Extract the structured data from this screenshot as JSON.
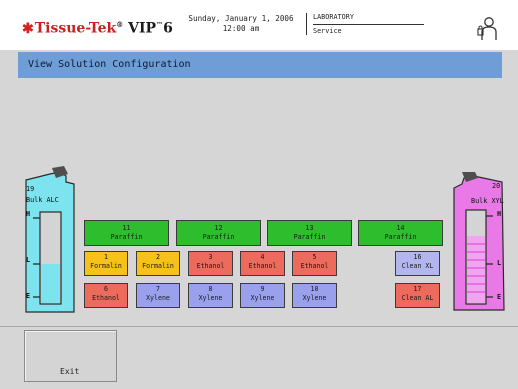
{
  "header": {
    "logo_brand": "Tissue-Tek",
    "logo_reg": "®",
    "logo_model": "VIP",
    "logo_tm": "™",
    "logo_number": "6",
    "date": "Sunday, January 1, 2006",
    "time": "12:00 am",
    "location": "LABORATORY",
    "user_level": "Service",
    "user_icon": "operator-icon"
  },
  "titlebar": {
    "title": "View Solution Configuration"
  },
  "bulk_left": {
    "number": "19",
    "label": "Bulk ALC",
    "level_high": "H",
    "level_low": "L",
    "level_empty": "E",
    "color": "#7de3ef"
  },
  "bulk_right": {
    "number": "20",
    "label": "Bulk XYL",
    "level_high": "H",
    "level_low": "L",
    "level_empty": "E",
    "color": "#e879e6"
  },
  "stations": {
    "s11": {
      "number": "11",
      "name": "Paraffin"
    },
    "s12": {
      "number": "12",
      "name": "Paraffin"
    },
    "s13": {
      "number": "13",
      "name": "Paraffin"
    },
    "s14": {
      "number": "14",
      "name": "Paraffin"
    },
    "s1": {
      "number": "1",
      "name": "Formalin"
    },
    "s2": {
      "number": "2",
      "name": "Formalin"
    },
    "s3": {
      "number": "3",
      "name": "Ethanol"
    },
    "s4": {
      "number": "4",
      "name": "Ethanol"
    },
    "s5": {
      "number": "5",
      "name": "Ethanol"
    },
    "s16": {
      "number": "16",
      "name": "Clean XL"
    },
    "s6": {
      "number": "6",
      "name": "Ethanol"
    },
    "s7": {
      "number": "7",
      "name": "Xylene"
    },
    "s8": {
      "number": "8",
      "name": "Xylene"
    },
    "s9": {
      "number": "9",
      "name": "Xylene"
    },
    "s10": {
      "number": "10",
      "name": "Xylene"
    },
    "s17": {
      "number": "17",
      "name": "Clean AL"
    }
  },
  "colors": {
    "paraffin": "#2dbd2d",
    "formalin": "#f6c21a",
    "ethanol": "#ec6b5d",
    "xylene": "#9aa0ec",
    "title_bar": "#6f9dd5"
  },
  "footer": {
    "exit_label": "Exit"
  }
}
